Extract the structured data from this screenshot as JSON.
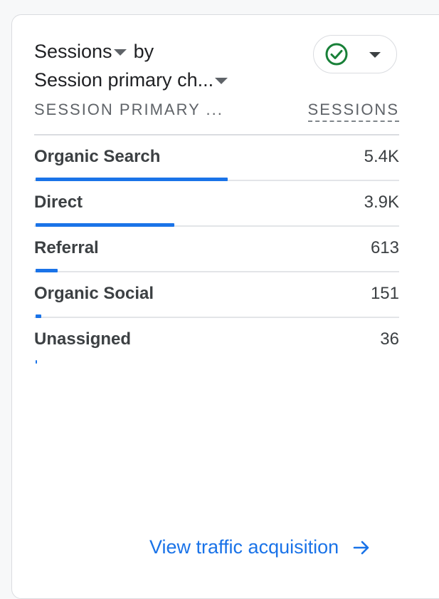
{
  "card": {
    "metric_label": "Sessions",
    "by_label": "by",
    "dimension_label": "Session primary ch...",
    "columns": {
      "dimension": "SESSION PRIMARY ...",
      "metric": "SESSIONS"
    },
    "rows": [
      {
        "label": "Organic Search",
        "value": "5.4K",
        "share": 0.53
      },
      {
        "label": "Direct",
        "value": "3.9K",
        "share": 0.382
      },
      {
        "label": "Referral",
        "value": "613",
        "share": 0.06
      },
      {
        "label": "Organic Social",
        "value": "151",
        "share": 0.015
      },
      {
        "label": "Unassigned",
        "value": "36",
        "share": 0.004
      }
    ],
    "link_label": "View traffic acquisition"
  },
  "icons": {
    "status": "check-circle-icon",
    "dropdown": "caret-down-icon",
    "link": "arrow-right-icon"
  },
  "colors": {
    "accent": "#1a73e8",
    "check": "#188038"
  }
}
